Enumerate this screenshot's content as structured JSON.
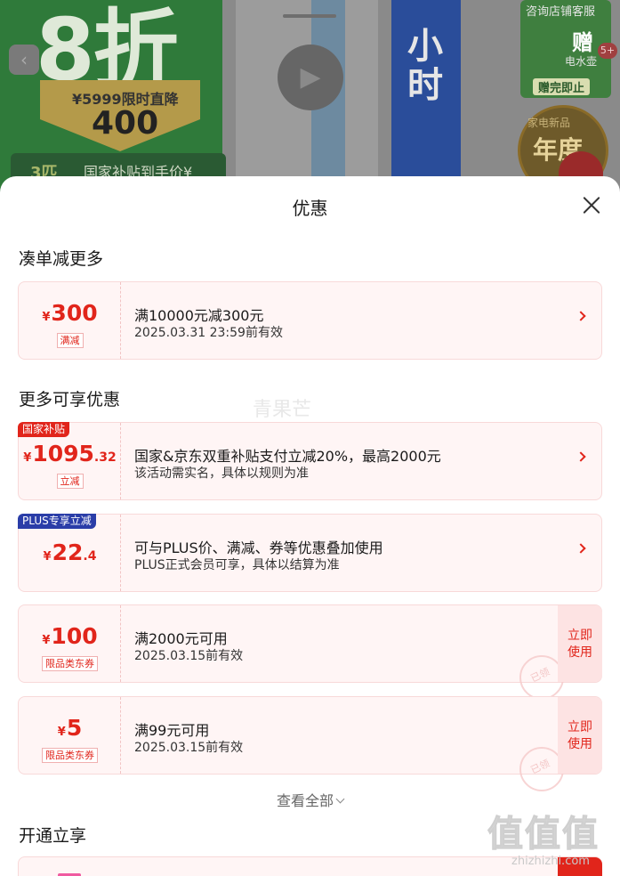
{
  "backdrop": {
    "promo_big": "8折",
    "promo_price": "¥5999限时直降",
    "promo_drop": "400",
    "promo_count": "3匹",
    "promo_subsidy": "国家补贴到手价¥",
    "vertical_text": "小时",
    "shop_consult": "咨询店铺客服",
    "gift": "赠",
    "gift_item": "电水壶",
    "gift_until": "赠完即止",
    "badge_top": "家电新品",
    "badge_main": "年度",
    "notif_count": "5+"
  },
  "sheet": {
    "title": "优惠"
  },
  "sections": {
    "combine": "凑单减更多",
    "more": "更多可享优惠",
    "open": "开通立享"
  },
  "cards": [
    {
      "currency": "¥",
      "amount": "300",
      "decimal": "",
      "tag": "满减",
      "corner": "",
      "main": "满10000元减300元",
      "sub": "2025.03.31 23:59前有效"
    },
    {
      "currency": "¥",
      "amount": "1095",
      "decimal": ".32",
      "tag": "立减",
      "corner": "国家补贴",
      "main": "国家&京东双重补贴支付立减20%，最高2000元",
      "sub": "该活动需实名，具体以规则为准"
    },
    {
      "currency": "¥",
      "amount": "22",
      "decimal": ".4",
      "tag": "",
      "corner": "PLUS专享立减",
      "main": "可与PLUS价、满减、券等优惠叠加使用",
      "sub": "PLUS正式会员可享，具体以结算为准"
    },
    {
      "currency": "¥",
      "amount": "100",
      "decimal": "",
      "tag": "限品类东券",
      "corner": "",
      "main": "满2000元可用",
      "sub": "2025.03.15前有效",
      "action": "立即使用",
      "stamp": "已领"
    },
    {
      "currency": "¥",
      "amount": "5",
      "decimal": "",
      "tag": "限品类东券",
      "corner": "",
      "main": "满99元可用",
      "sub": "2025.03.15前有效",
      "action": "立即使用",
      "stamp": "已领"
    }
  ],
  "view_all": "查看全部",
  "watermark": "青果芒",
  "site_watermark": {
    "logo": "值值值",
    "url": "zhizhizhi.com"
  },
  "colors": {
    "accent": "#e1251b",
    "card_bg": "#fff5f5",
    "plus_blue": "#2a3da8"
  }
}
